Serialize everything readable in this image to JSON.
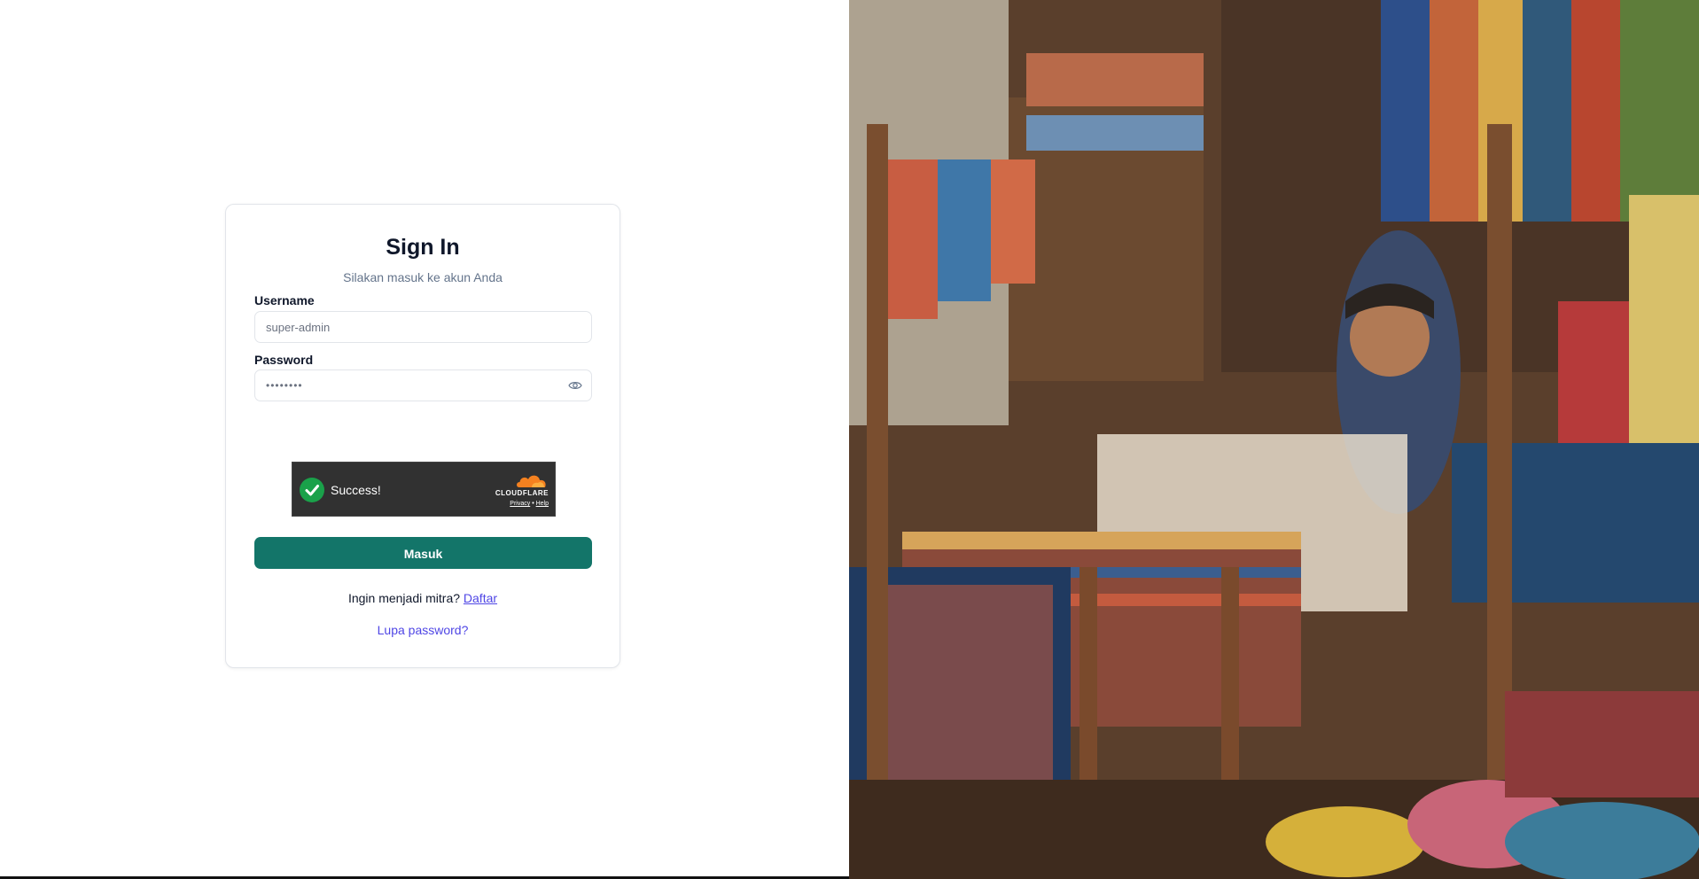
{
  "login": {
    "title": "Sign In",
    "subtitle": "Silakan masuk ke akun Anda",
    "username_label": "Username",
    "username_placeholder": "super-admin",
    "password_label": "Password",
    "password_value": "••••••••",
    "submit_label": "Masuk",
    "register_prompt": "Ingin menjadi mitra?",
    "register_link": "Daftar",
    "forgot_password": "Lupa password?"
  },
  "captcha": {
    "status": "Success!",
    "brand": "CLOUDFLARE",
    "privacy": "Privacy",
    "separator": "•",
    "help": "Help"
  },
  "colors": {
    "primary": "#137569",
    "link": "#4f46e5",
    "success": "#1aa14a",
    "cloudflare_orange": "#f48120"
  },
  "icons": {
    "password_toggle": "eye-icon",
    "captcha_status": "check-circle-icon",
    "captcha_logo": "cloud-icon"
  }
}
